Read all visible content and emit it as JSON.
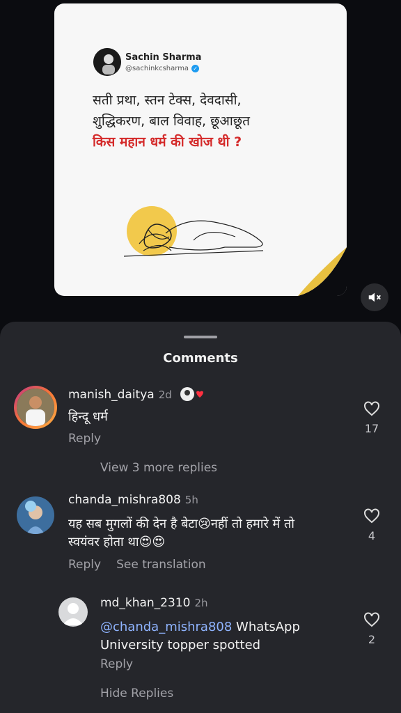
{
  "post": {
    "author_name": "Sachin Sharma",
    "author_handle": "@sachinkcsharma",
    "line1": "सती प्रथा, स्तन टेक्स, देवदासी,",
    "line2": "शुद्धिकरण, बाल विवाह, छूआछूत",
    "line3": "किस महान धर्म की खोज थी ?",
    "accent_yellow": "#f2c94c",
    "accent_red": "#d42a2a"
  },
  "sheet": {
    "title": "Comments"
  },
  "comments": [
    {
      "username": "manish_daitya",
      "time": "2d",
      "text": "हिन्दू धर्म",
      "likes": "17",
      "reply_label": "Reply",
      "view_replies": "View 3 more replies"
    },
    {
      "username": "chanda_mishra808",
      "time": "5h",
      "text_line1": "यह सब मुगलों की देन है बेटा😢नहीं तो हमारे में तो",
      "text_line2": "स्वयंवर होता था😍😍",
      "likes": "4",
      "reply_label": "Reply",
      "translate_label": "See translation"
    },
    {
      "username": "md_khan_2310",
      "time": "2h",
      "mention": "@chanda_mishra808",
      "text_line1": " WhatsApp",
      "text_line2": "University topper spotted",
      "likes": "2",
      "reply_label": "Reply",
      "hide_replies": "Hide Replies"
    }
  ]
}
